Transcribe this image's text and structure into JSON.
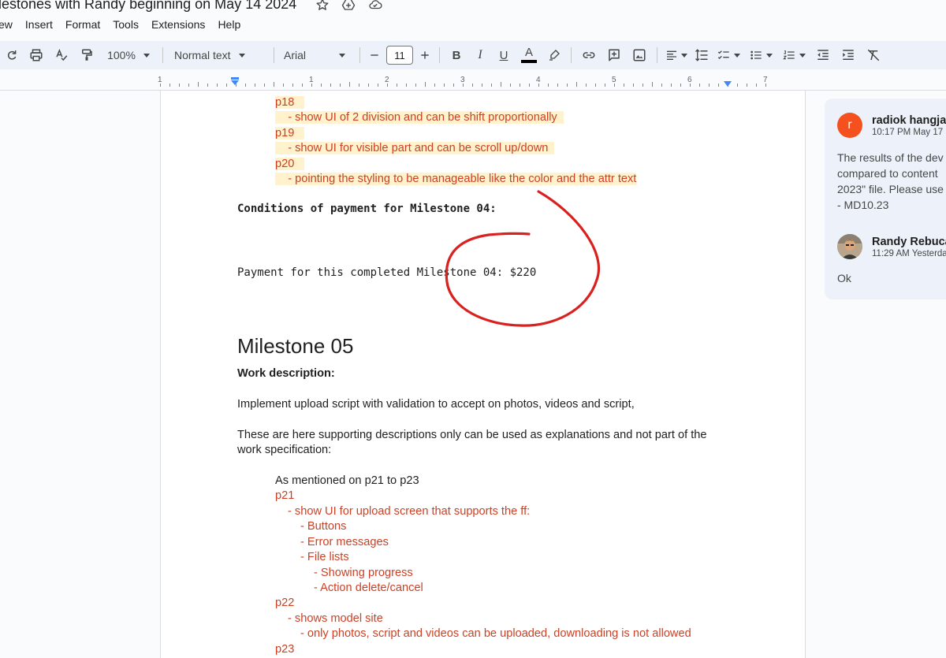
{
  "title": {
    "text": "ilestones with Randy beginning on May 14 2024",
    "icons": [
      "star-icon",
      "move-to-drive-icon",
      "cloud-status-icon"
    ]
  },
  "menu": [
    "ew",
    "Insert",
    "Format",
    "Tools",
    "Extensions",
    "Help"
  ],
  "toolbar": {
    "zoom": "100%",
    "style": "Normal text",
    "font": "Arial",
    "font_size": "11",
    "bold": "B",
    "italic": "I",
    "underline": "U",
    "text_color_letter": "A"
  },
  "ruler": {
    "numbers": [
      "1",
      "1",
      "2",
      "3",
      "4",
      "5",
      "6",
      "7"
    ]
  },
  "document": {
    "p18": "p18",
    "p18_item": "- show UI of 2 division and can be shift proportionally",
    "p19": "p19",
    "p19_item": "- show UI for visible part and can be scroll up/down",
    "p20": "p20",
    "p20_item": "- pointing the styling to be manageable like the color and the attr text",
    "conditions_heading": "Conditions of payment for Milestone 04:",
    "payment_text": "Payment for this completed Milestone 04: $220",
    "milestone_heading": "Milestone 05",
    "work_desc_label": "Work description:",
    "work_desc_text": "Implement upload script with validation to accept on photos, videos and script,",
    "support_line1": "These are here supporting descriptions only can be used as explanations and not part of the",
    "support_line2": "work specification:",
    "mentioned": "As mentioned on p21 to p23",
    "p21": "p21",
    "p21_item": "- show UI for upload screen that supports the ff:",
    "p21_sub1": "- Buttons",
    "p21_sub2": "- Error messages",
    "p21_sub3": "- File lists",
    "p21_sub3a": "- Showing progress",
    "p21_sub3b": "- Action delete/cancel",
    "p22": "p22",
    "p22_item": "- shows model site",
    "p22_sub1": "- only photos, script and videos can be uploaded, downloading is not allowed",
    "p23": "p23"
  },
  "comments": {
    "c1_avatar": "r",
    "c1_name": "radiok hangja",
    "c1_time": "10:17 PM May 17",
    "c1_line1": "The results of the dev",
    "c1_line2": "compared to content",
    "c1_line3": "2023\" file. Please use",
    "c1_line4": "- MD10.23",
    "c2_name": "Randy Rebuca",
    "c2_time": "11:29 AM Yesterda",
    "c2_text": "Ok"
  },
  "colors": {
    "red_text": "#cc4125",
    "highlight": "#fff2cc",
    "annotation": "#d9221f",
    "toolbar_bg": "#edf2fa",
    "avatar_r": "#f4511e"
  }
}
